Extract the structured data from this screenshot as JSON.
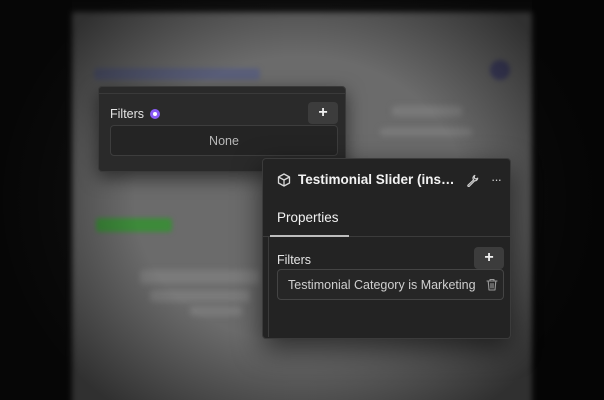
{
  "filters_panel": {
    "filters_label": "Filters",
    "add_label": "+",
    "value": "None"
  },
  "element_panel": {
    "title": "Testimonial Slider (instance)",
    "more_label": "···",
    "tab_label": "Properties",
    "filters_label": "Filters",
    "add_label": "+",
    "filter_rule": "Testimonial Category is Marketing"
  },
  "icons": {
    "header": "cube-icon",
    "settings": "wrench-icon",
    "more": "more-icon",
    "delete": "trash-icon",
    "badge": "dot-badge-icon"
  },
  "colors": {
    "accent": "#8a5cf6",
    "panel_bg": "#232323",
    "success_bg": "#3d8a3a"
  }
}
